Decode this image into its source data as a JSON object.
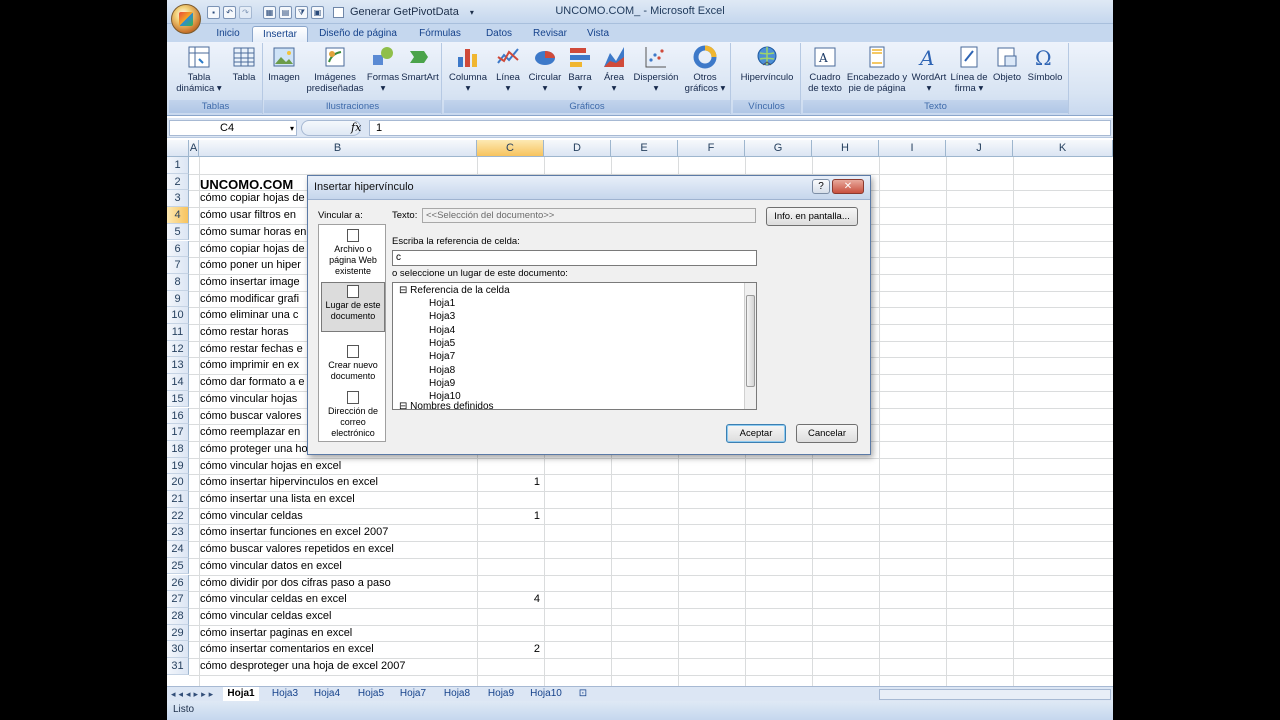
{
  "window": {
    "title": "UNCOMO.COM_ - Microsoft Excel"
  },
  "qat": {
    "checkbox_label": "Generar GetPivotData"
  },
  "tabs": [
    "Inicio",
    "Insertar",
    "Diseño de página",
    "Fórmulas",
    "Datos",
    "Revisar",
    "Vista"
  ],
  "ribbon": {
    "groups": {
      "tablas": "Tablas",
      "ilustraciones": "Ilustraciones",
      "graficos": "Gráficos",
      "vinculos": "Vínculos",
      "texto": "Texto"
    },
    "buttons": {
      "tabla_dinamica_1": "Tabla",
      "tabla_dinamica_2": "dinámica",
      "tabla": "Tabla",
      "imagen": "Imagen",
      "imagenes_1": "Imágenes",
      "imagenes_2": "prediseñadas",
      "formas": "Formas",
      "smartart": "SmartArt",
      "columna": "Columna",
      "linea": "Línea",
      "circular": "Circular",
      "barra": "Barra",
      "area": "Área",
      "dispersion": "Dispersión",
      "otros_1": "Otros",
      "otros_2": "gráficos",
      "hipervinculo": "Hipervínculo",
      "cuadro_1": "Cuadro",
      "cuadro_2": "de texto",
      "encabezado_1": "Encabezado y",
      "encabezado_2": "pie de página",
      "wordart": "WordArt",
      "lineafirma_1": "Línea de",
      "lineafirma_2": "firma",
      "objeto": "Objeto",
      "simbolo": "Símbolo"
    }
  },
  "formula_bar": {
    "name_box": "C4",
    "fx": "fx",
    "value": "1"
  },
  "columns": [
    "A",
    "B",
    "C",
    "D",
    "E",
    "F",
    "G",
    "H",
    "I",
    "J",
    "K"
  ],
  "rows": [
    "1",
    "2",
    "3",
    "4",
    "5",
    "6",
    "7",
    "8",
    "9",
    "10",
    "11",
    "12",
    "13",
    "14",
    "15",
    "16",
    "17",
    "18",
    "19",
    "20",
    "21",
    "22",
    "23",
    "24",
    "25",
    "26",
    "27",
    "28",
    "29",
    "30",
    "31"
  ],
  "cells": {
    "b2": "UNCOMO.COM",
    "b3": "cómo copiar hojas de",
    "b4": "cómo usar filtros en",
    "b5": "cómo sumar horas en",
    "b6": "cómo copiar hojas de",
    "b7": "cómo poner un hiper",
    "b8": "cómo insertar image",
    "b9": "cómo modificar grafi",
    "b10": "cómo eliminar una c",
    "b11": "cómo restar horas",
    "b12": "cómo restar fechas e",
    "b13": "cómo imprimir en ex",
    "b14": "cómo dar formato a e",
    "b15": "cómo vincular hojas",
    "b16": "cómo buscar valores",
    "b17": "cómo reemplazar en",
    "b18": "cómo proteger una hoja de excel 2007",
    "b19": "cómo vincular hojas en excel",
    "b20": "cómo insertar hipervinculos en excel",
    "b21": "cómo insertar una lista en excel",
    "b22": "cómo vincular celdas",
    "b23": "cómo insertar funciones en excel 2007",
    "b24": "cómo buscar valores repetidos en excel",
    "b25": "cómo vincular datos en excel",
    "b26": "cómo dividir por dos cifras paso a paso",
    "b27": "cómo vincular celdas en excel",
    "b28": "cómo vincular celdas excel",
    "b29": "cómo insertar paginas en excel",
    "b30": "cómo insertar comentarios en excel",
    "b31": "cómo desproteger una hoja de excel 2007",
    "c20": "1",
    "c22": "1",
    "c27": "4",
    "c30": "2"
  },
  "sheet_tabs": [
    "Hoja1",
    "Hoja3",
    "Hoja4",
    "Hoja5",
    "Hoja7",
    "Hoja8",
    "Hoja9",
    "Hoja10"
  ],
  "status": {
    "text": "Listo"
  },
  "dialog": {
    "title": "Insertar hipervínculo",
    "help": "?",
    "close": "✕",
    "vincular_label": "Vincular a:",
    "texto_label": "Texto:",
    "texto_value": "<<Selección del documento>>",
    "info_button": "Info. en pantalla...",
    "ref_label": "Escriba la referencia de celda:",
    "ref_value": "c",
    "place_label": "o seleccione un lugar de este documento:",
    "link_options": {
      "archivo": "Archivo o página Web existente",
      "lugar": "Lugar de este documento",
      "nuevo": "Crear nuevo documento",
      "correo": "Dirección de correo electrónico"
    },
    "tree": {
      "root": "Referencia de la celda",
      "items": [
        "Hoja1",
        "Hoja3",
        "Hoja4",
        "Hoja5",
        "Hoja7",
        "Hoja8",
        "Hoja9",
        "Hoja10"
      ],
      "names": "Nombres definidos"
    },
    "accept": "Aceptar",
    "cancel": "Cancelar"
  }
}
